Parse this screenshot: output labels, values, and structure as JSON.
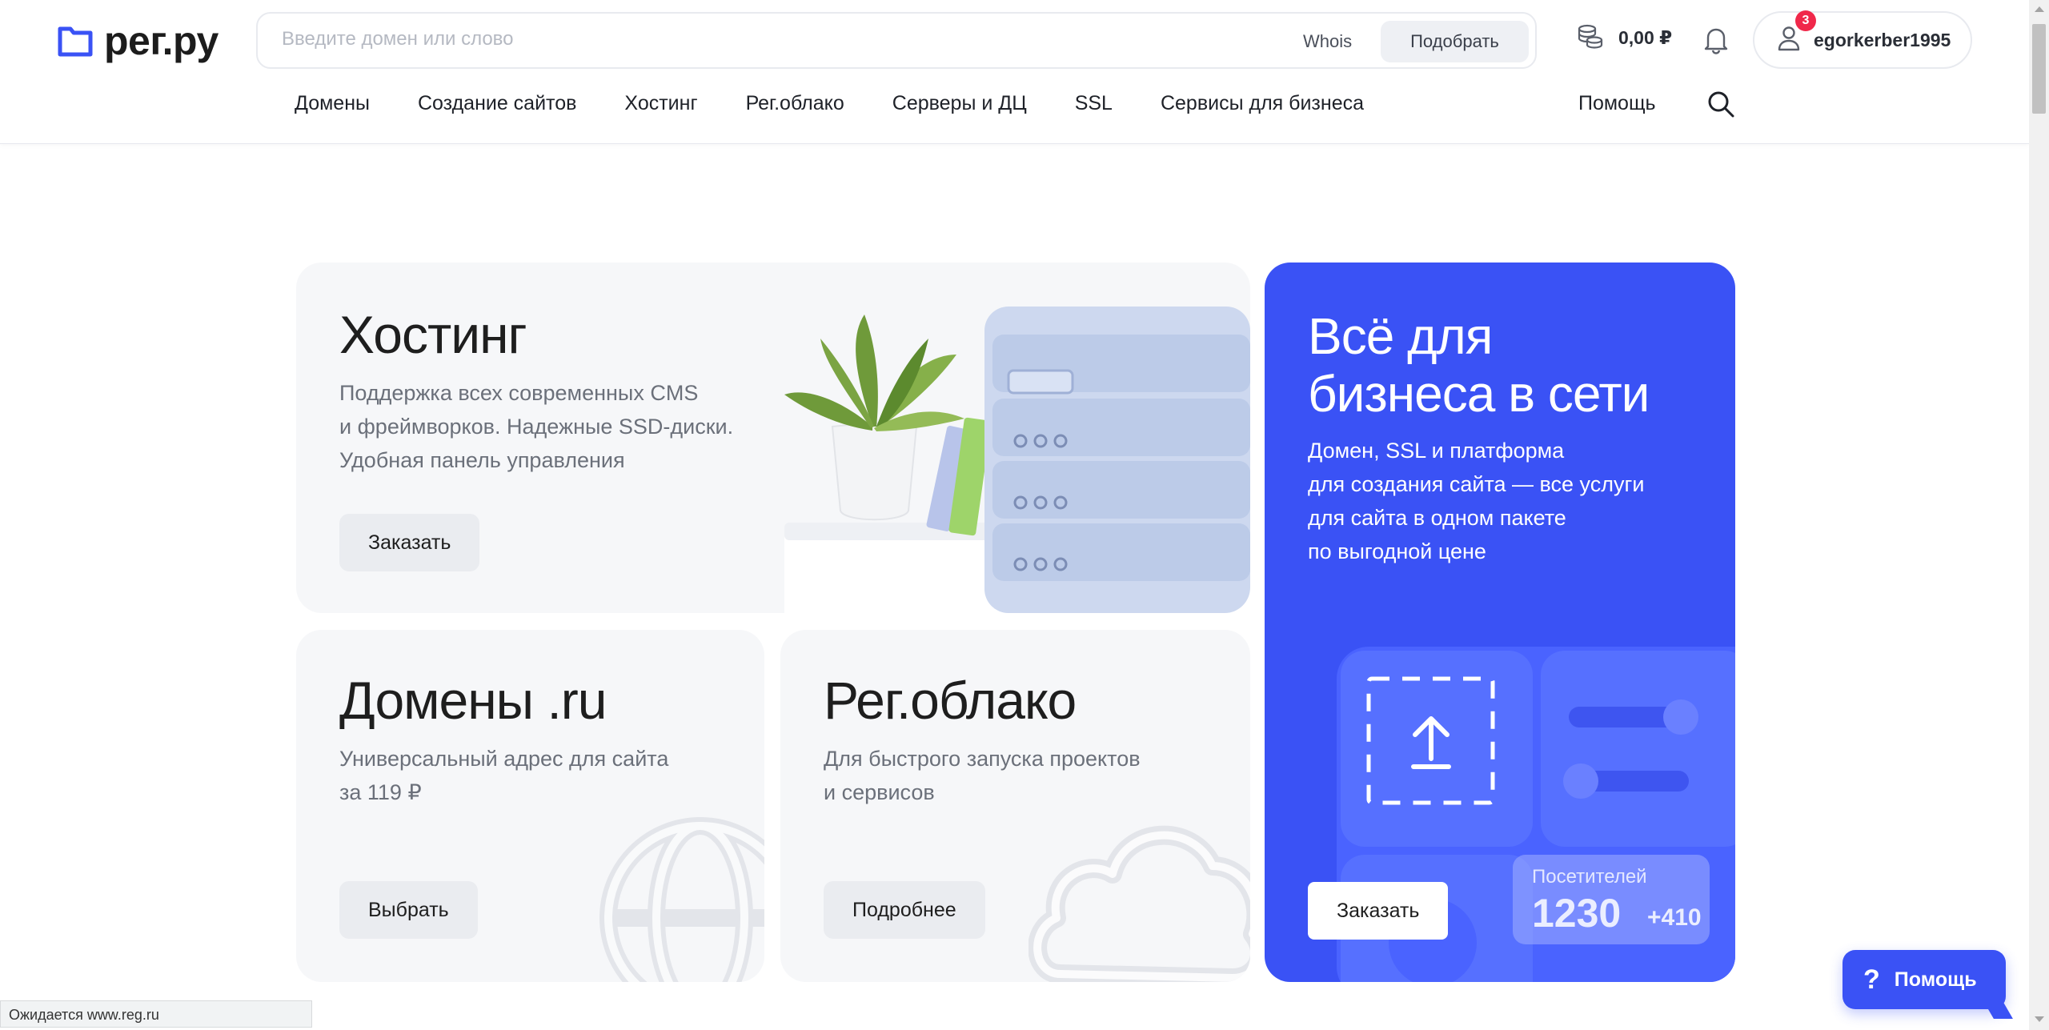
{
  "brand": {
    "logo_text": "рег.ру",
    "accent_color": "#3a52f5",
    "badge_color": "#f0284a"
  },
  "header": {
    "search_placeholder": "Введите домен или слово",
    "whois_label": "Whois",
    "pick_label": "Подобрать",
    "balance": "0,00 ₽",
    "username": "egorkerber1995",
    "notification_count": "3"
  },
  "nav": {
    "items": [
      {
        "label": "Домены"
      },
      {
        "label": "Создание сайтов"
      },
      {
        "label": "Хостинг"
      },
      {
        "label": "Рег.облако"
      },
      {
        "label": "Серверы и ДЦ"
      },
      {
        "label": "SSL"
      },
      {
        "label": "Сервисы для бизнеса"
      }
    ],
    "help_label": "Помощь"
  },
  "cards": {
    "hosting": {
      "title": "Хостинг",
      "desc_lines": [
        "Поддержка всех современных CMS",
        "и фреймворков. Надежные SSD-диски.",
        "Удобная панель управления"
      ],
      "button": "Заказать"
    },
    "domains": {
      "title": "Домены .ru",
      "desc_lines": [
        "Универсальный адрес для сайта",
        "за 119 ₽"
      ],
      "button": "Выбрать"
    },
    "cloud": {
      "title": "Рег.облако",
      "desc_lines": [
        "Для быстрого запуска проектов",
        "и сервисов"
      ],
      "button": "Подробнее"
    },
    "business": {
      "title_lines": [
        "Всё для",
        "бизнеса в сети"
      ],
      "desc_lines": [
        "Домен, SSL и платформа",
        "для создания сайта — все услуги",
        "для сайта в одном пакете",
        "по выгодной цене"
      ],
      "button": "Заказать",
      "visitors_label": "Посетителей",
      "visitors_count": "1230",
      "visitors_delta": "+410"
    }
  },
  "help_widget": {
    "label": "Помощь",
    "icon": "question-icon"
  },
  "status_bar": {
    "text": "Ожидается www.reg.ru"
  }
}
